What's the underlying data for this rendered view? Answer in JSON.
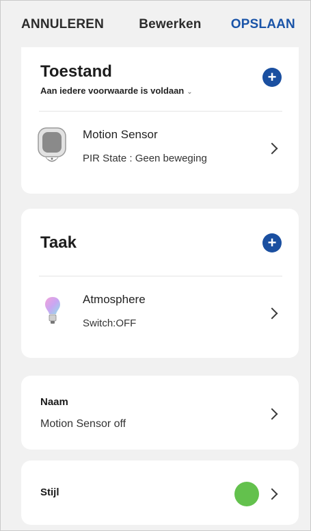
{
  "header": {
    "cancel_label": "ANNULEREN",
    "title": "Bewerken",
    "save_label": "OPSLAAN"
  },
  "condition": {
    "title": "Toestand",
    "subtitle": "Aan iedere voorwaarde is voldaan",
    "add_icon": "plus-circle-icon",
    "device": {
      "icon": "motion-sensor-icon",
      "name": "Motion Sensor",
      "detail": "PIR State : Geen beweging"
    }
  },
  "task": {
    "title": "Taak",
    "add_icon": "plus-circle-icon",
    "device": {
      "icon": "light-bulb-icon",
      "name": "Atmosphere",
      "detail": "Switch:OFF"
    }
  },
  "name_row": {
    "label": "Naam",
    "value": "Motion Sensor off"
  },
  "style_row": {
    "label": "Stijl",
    "color": "#63c14d"
  },
  "colors": {
    "accent": "#1a4fa0",
    "save": "#1a54a8",
    "style_swatch": "#63c14d"
  }
}
